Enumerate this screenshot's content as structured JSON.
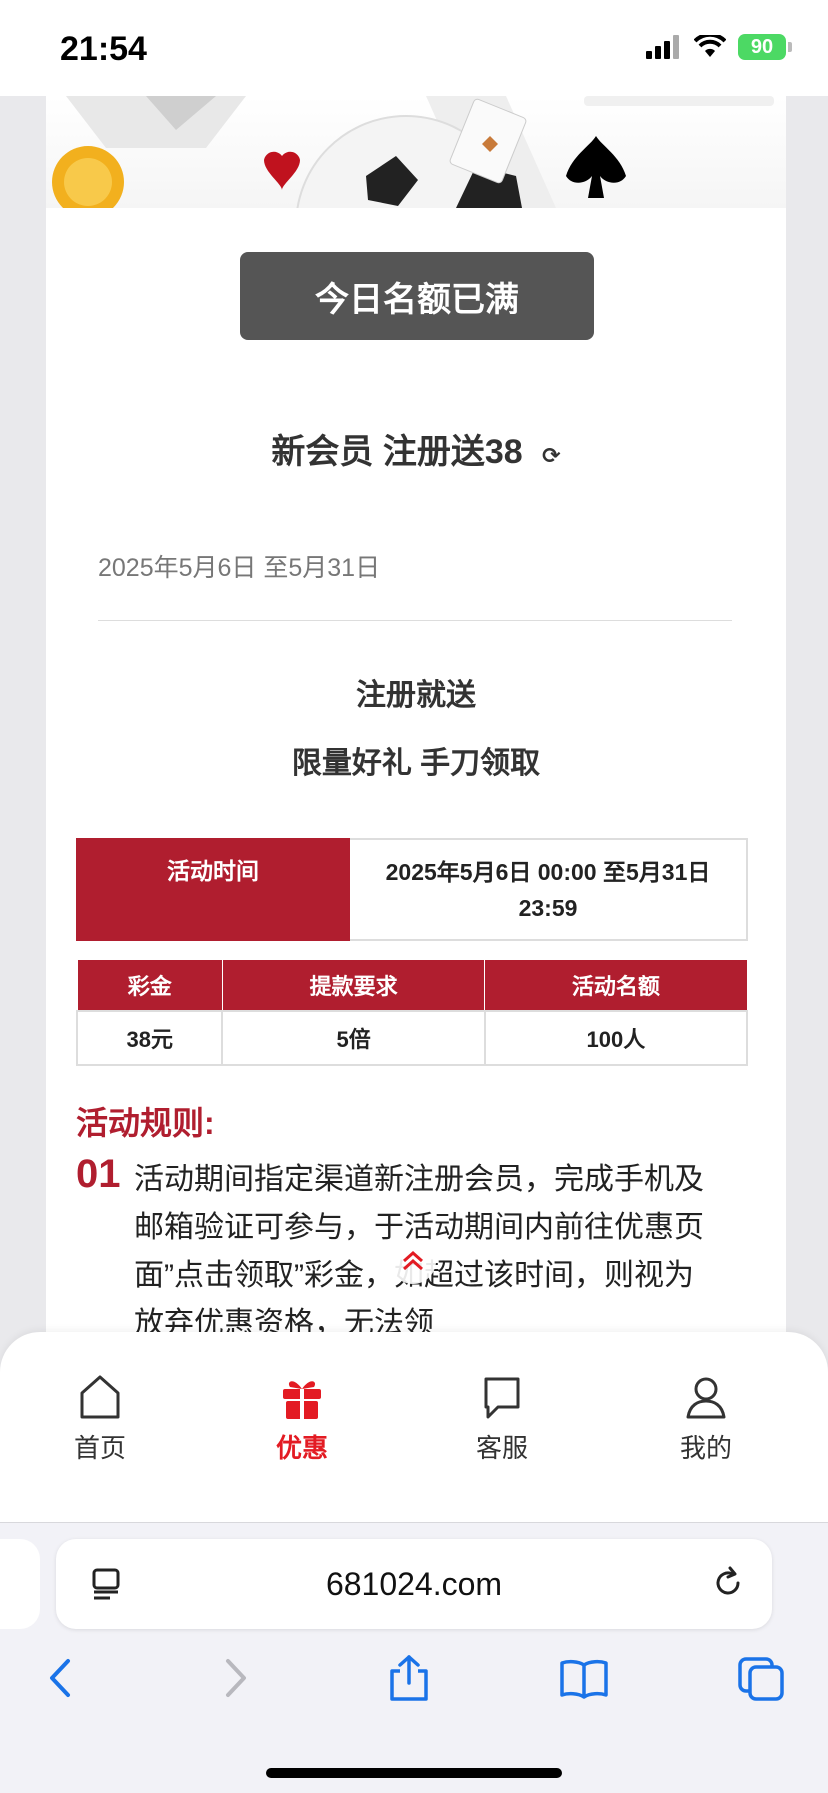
{
  "status_bar": {
    "time": "21:54",
    "battery": "90"
  },
  "promo": {
    "quota_button": "今日名额已满",
    "title": "新会员 注册送38",
    "refresh_glyph": "⟳",
    "date_range": "2025年5月6日 至5月31日",
    "desc_line1": "注册就送",
    "desc_line2": "限量好礼 手刀领取"
  },
  "activity_time": {
    "label": "活动时间",
    "value": "2025年5月6日 00:00 至5月31日 23:59"
  },
  "bonus_table": {
    "headers": [
      "彩金",
      "提款要求",
      "活动名额"
    ],
    "values": [
      "38元",
      "5倍",
      "100人"
    ]
  },
  "rules": {
    "title": "活动规则:",
    "items": [
      {
        "num": "01",
        "text": "活动期间指定渠道新注册会员，完成手机及邮箱验证可参与，于活动期间内前往优惠页面”点击领取”彩金，如超过该时间，则视为放弃优惠资格，无法领"
      }
    ]
  },
  "tabbar": {
    "items": [
      {
        "label": "首页",
        "icon": "home-icon"
      },
      {
        "label": "优惠",
        "icon": "gift-icon",
        "active": true
      },
      {
        "label": "客服",
        "icon": "chat-icon"
      },
      {
        "label": "我的",
        "icon": "user-icon"
      }
    ]
  },
  "browser": {
    "url": "681024.com"
  },
  "colors": {
    "accent": "#e31b23",
    "table_header": "#b01e2f",
    "disabled_button": "#555555"
  }
}
